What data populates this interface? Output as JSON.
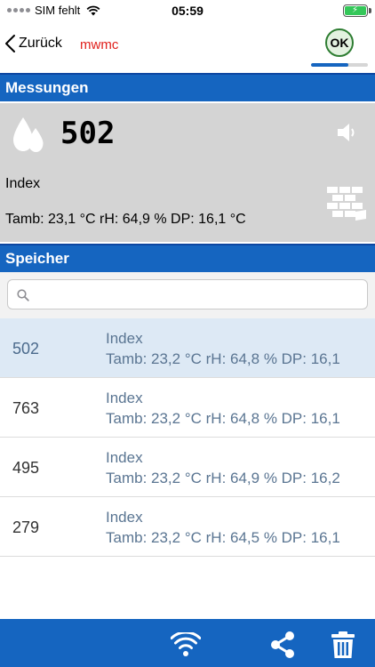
{
  "status_bar": {
    "carrier": "SIM fehlt",
    "time": "05:59",
    "battery_color": "#34c759"
  },
  "nav": {
    "back_label": "Zurück",
    "title": "mwmc",
    "ok_label": "OK",
    "progress_fraction": 0.65
  },
  "sections": {
    "measurements": "Messungen",
    "storage": "Speicher"
  },
  "measurement": {
    "value": "502",
    "mode": "Index",
    "ambient": "Tamb: 23,1 °C rH: 64,9 % DP: 16,1 °C",
    "icons": [
      "water-drop-icon",
      "speaker-icon",
      "brick-wall-icon"
    ]
  },
  "search": {
    "placeholder": "",
    "value": ""
  },
  "records": [
    {
      "value": "502",
      "mode": "Index",
      "detail": "Tamb: 23,2 °C rH: 64,8 % DP: 16,1",
      "selected": true
    },
    {
      "value": "763",
      "mode": "Index",
      "detail": "Tamb: 23,2 °C rH: 64,8 % DP: 16,1",
      "selected": false
    },
    {
      "value": "495",
      "mode": "Index",
      "detail": "Tamb: 23,2 °C rH: 64,9 % DP: 16,2",
      "selected": false
    },
    {
      "value": "279",
      "mode": "Index",
      "detail": "Tamb: 23,2 °C rH: 64,5 % DP: 16,1",
      "selected": false
    }
  ],
  "toolbar": {
    "icons": [
      "wifi-icon",
      "share-icon",
      "trash-icon"
    ]
  },
  "colors": {
    "primary_blue": "#1565c0",
    "title_red": "#e0201c",
    "panel_gray": "#d4d4d4",
    "selected_row": "#dde9f5"
  }
}
